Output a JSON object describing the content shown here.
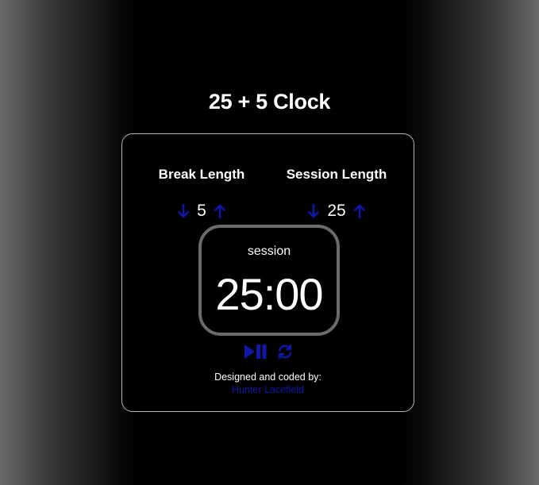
{
  "app": {
    "title": "25 + 5 Clock"
  },
  "break": {
    "label": "Break Length",
    "value": "5",
    "decrement_icon": "arrow-down-icon",
    "increment_icon": "arrow-up-icon"
  },
  "session": {
    "label": "Session Length",
    "value": "25",
    "decrement_icon": "arrow-down-icon",
    "increment_icon": "arrow-up-icon"
  },
  "timer": {
    "label": "session",
    "time_left": "25:00"
  },
  "controls": {
    "start_stop_icon": "play-pause-icon",
    "reset_icon": "refresh-icon"
  },
  "footer": {
    "credit_text": "Designed and coded by:",
    "author": "Hunter Lacefield"
  },
  "colors": {
    "background": "#000000",
    "accent": "#0d17a8",
    "card_border": "#b5b5b5",
    "timer_border": "#6b6b6b",
    "text": "#ffffff"
  }
}
